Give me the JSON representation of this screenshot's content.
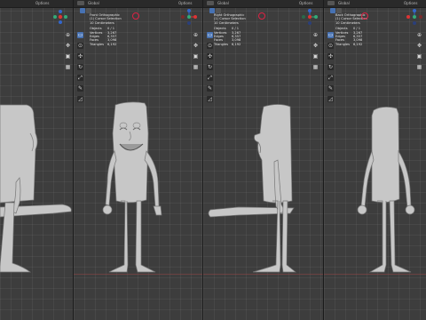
{
  "viewports": [
    {
      "view_label": "",
      "stats": []
    },
    {
      "view_label": "Front Orthographic",
      "sub1": "(1) Cursor Selection",
      "sub2": "10 Centimeters",
      "stats": [
        {
          "k": "Objects",
          "v": "0 / 1"
        },
        {
          "k": "Vertices",
          "v": "3,267"
        },
        {
          "k": "Edges",
          "v": "6,357"
        },
        {
          "k": "Faces",
          "v": "3,098"
        },
        {
          "k": "Triangles",
          "v": "6,192"
        }
      ]
    },
    {
      "view_label": "Right Orthographic",
      "sub1": "(1) Cursor Selection",
      "sub2": "10 Centimeters",
      "stats": [
        {
          "k": "Objects",
          "v": "0 / 1"
        },
        {
          "k": "Vertices",
          "v": "3,267"
        },
        {
          "k": "Edges",
          "v": "6,357"
        },
        {
          "k": "Faces",
          "v": "3,098"
        },
        {
          "k": "Triangles",
          "v": "6,192"
        }
      ]
    },
    {
      "view_label": "Back Orthographic",
      "sub1": "(1) Cursor Selection",
      "sub2": "10 Centimeters",
      "stats": [
        {
          "k": "Objects",
          "v": "0 / 1"
        },
        {
          "k": "Vertices",
          "v": "3,267"
        },
        {
          "k": "Edges",
          "v": "6,357"
        },
        {
          "k": "Faces",
          "v": "3,098"
        },
        {
          "k": "Triangles",
          "v": "6,192"
        }
      ]
    }
  ],
  "header": {
    "mode_label": "Global",
    "options_label": "Options"
  },
  "tool_icons": [
    "select-box",
    "cursor",
    "move",
    "rotate",
    "scale",
    "transform",
    "annotate",
    "measure"
  ]
}
